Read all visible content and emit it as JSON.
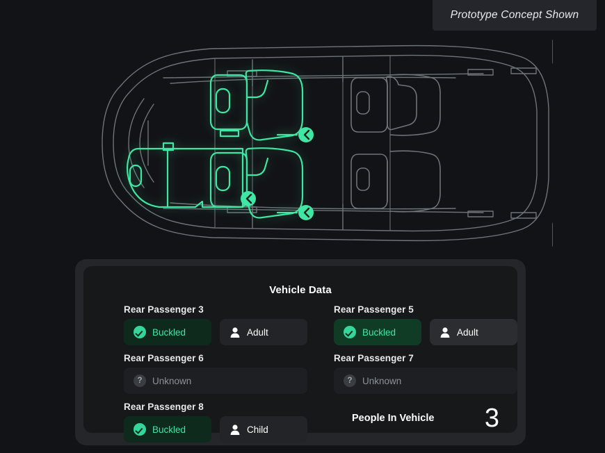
{
  "banner": {
    "text": "Prototype Concept Shown"
  },
  "vehicle": {
    "view": "top-down-vehicle-diagram",
    "highlight_color": "#3fe6a4",
    "outline_color": "#6e7479",
    "highlighted_seats": [
      {
        "name": "rear-passenger-3",
        "belt_badge": true
      },
      {
        "name": "rear-passenger-5",
        "belt_badge": true
      },
      {
        "name": "rear-passenger-8-bench",
        "belt_badge": true
      }
    ]
  },
  "panel": {
    "title": "Vehicle Data",
    "rows": [
      {
        "cells": [
          {
            "label": "Rear Passenger 3",
            "chips": [
              {
                "name": "belt-status",
                "icon": "check-circle-icon",
                "text": "Buckled",
                "style": "belt"
              },
              {
                "name": "occupant-type",
                "icon": "person-icon",
                "text": "Adult",
                "style": "person"
              }
            ]
          },
          {
            "label": "Rear Passenger 5",
            "chips": [
              {
                "name": "belt-status",
                "icon": "check-circle-icon",
                "text": "Buckled",
                "style": "belt-bright"
              },
              {
                "name": "occupant-type",
                "icon": "person-icon",
                "text": "Adult",
                "style": "person-bright"
              }
            ]
          }
        ]
      },
      {
        "cells": [
          {
            "label": "Rear Passenger 6",
            "chips": [
              {
                "name": "belt-status",
                "icon": "question-circle-icon",
                "text": "Unknown",
                "style": "unknown"
              }
            ]
          },
          {
            "label": "Rear Passenger 7",
            "chips": [
              {
                "name": "belt-status",
                "icon": "question-circle-icon",
                "text": "Unknown",
                "style": "unknown"
              }
            ]
          }
        ]
      }
    ],
    "last_row": {
      "label": "Rear Passenger 8",
      "chips": [
        {
          "name": "belt-status",
          "icon": "check-circle-icon",
          "text": "Buckled",
          "style": "belt"
        },
        {
          "name": "occupant-type",
          "icon": "person-icon",
          "text": "Child",
          "style": "person"
        }
      ]
    },
    "summary": {
      "label": "People In Vehicle",
      "value": "3"
    }
  },
  "colors": {
    "page_bg": "#121316",
    "panel_outer": "#242629",
    "panel_inner": "#17181a",
    "accent_green": "#3fe6a4",
    "chip_green_bg": "#0d2a1d",
    "muted_text": "#8d9196"
  }
}
